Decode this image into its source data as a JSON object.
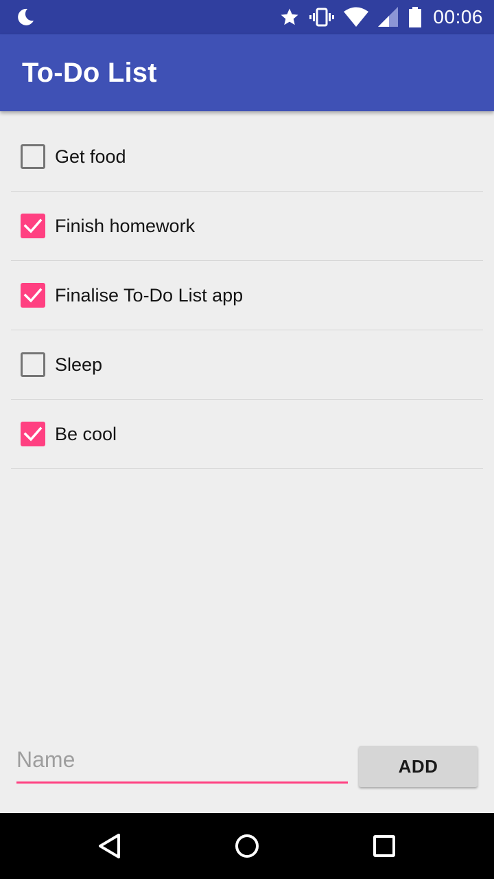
{
  "status_bar": {
    "time": "00:06",
    "icons": [
      "moon-icon",
      "star-icon",
      "vibrate-icon",
      "wifi-icon",
      "signal-icon",
      "battery-icon"
    ]
  },
  "app_bar": {
    "title": "To-Do List"
  },
  "todo_list": {
    "items": [
      {
        "label": "Get food",
        "checked": false
      },
      {
        "label": "Finish homework",
        "checked": true
      },
      {
        "label": "Finalise To-Do List app",
        "checked": true
      },
      {
        "label": "Sleep",
        "checked": false
      },
      {
        "label": "Be cool",
        "checked": true
      }
    ]
  },
  "add_form": {
    "name_placeholder": "Name",
    "name_value": "",
    "add_label": "ADD"
  },
  "nav_bar": {
    "icons": [
      "back-icon",
      "home-icon",
      "recents-icon"
    ]
  },
  "colors": {
    "status_bar": "#303f9f",
    "app_bar": "#3f51b5",
    "accent": "#ff4081",
    "background": "#eeeeee",
    "nav_bar": "#000000"
  }
}
